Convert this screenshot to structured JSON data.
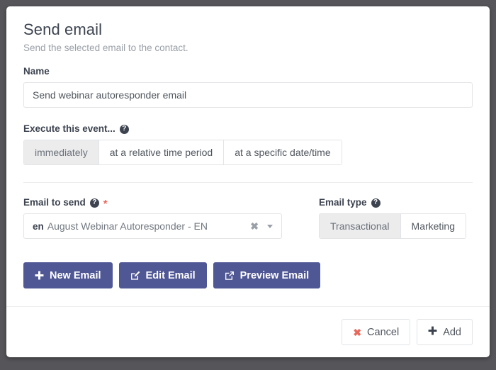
{
  "dialog": {
    "title": "Send email",
    "subtitle": "Send the selected email to the contact."
  },
  "name_field": {
    "label": "Name",
    "value": "Send webinar autoresponder email",
    "placeholder": "Name"
  },
  "execute": {
    "label": "Execute this event...",
    "help_icon": "question-circle-icon",
    "options": [
      {
        "label": "immediately",
        "active": true
      },
      {
        "label": "at a relative time period",
        "active": false
      },
      {
        "label": "at a specific date/time",
        "active": false
      }
    ]
  },
  "email_to_send": {
    "label": "Email to send",
    "help_icon": "question-circle-icon",
    "required_marker": "*",
    "language_code": "en",
    "value": "August Webinar Autoresponder - EN",
    "clear_icon": "close-icon",
    "caret_icon": "chevron-down-icon"
  },
  "email_type": {
    "label": "Email type",
    "help_icon": "question-circle-icon",
    "options": [
      {
        "label": "Transactional",
        "active": true
      },
      {
        "label": "Marketing",
        "active": false
      }
    ]
  },
  "actions": [
    {
      "label": "New Email",
      "icon": "plus-icon"
    },
    {
      "label": "Edit Email",
      "icon": "pencil-square-icon"
    },
    {
      "label": "Preview Email",
      "icon": "external-link-icon"
    }
  ],
  "footer": {
    "cancel_label": "Cancel",
    "cancel_icon": "close-icon",
    "add_label": "Add",
    "add_icon": "plus-icon"
  },
  "colors": {
    "primary": "#4f5795",
    "danger": "#e8695c",
    "text": "#3d4450",
    "muted": "#9aa0a8",
    "border": "#e2e4e7",
    "page_background": "#56565a",
    "segment_active": "#ececed"
  }
}
